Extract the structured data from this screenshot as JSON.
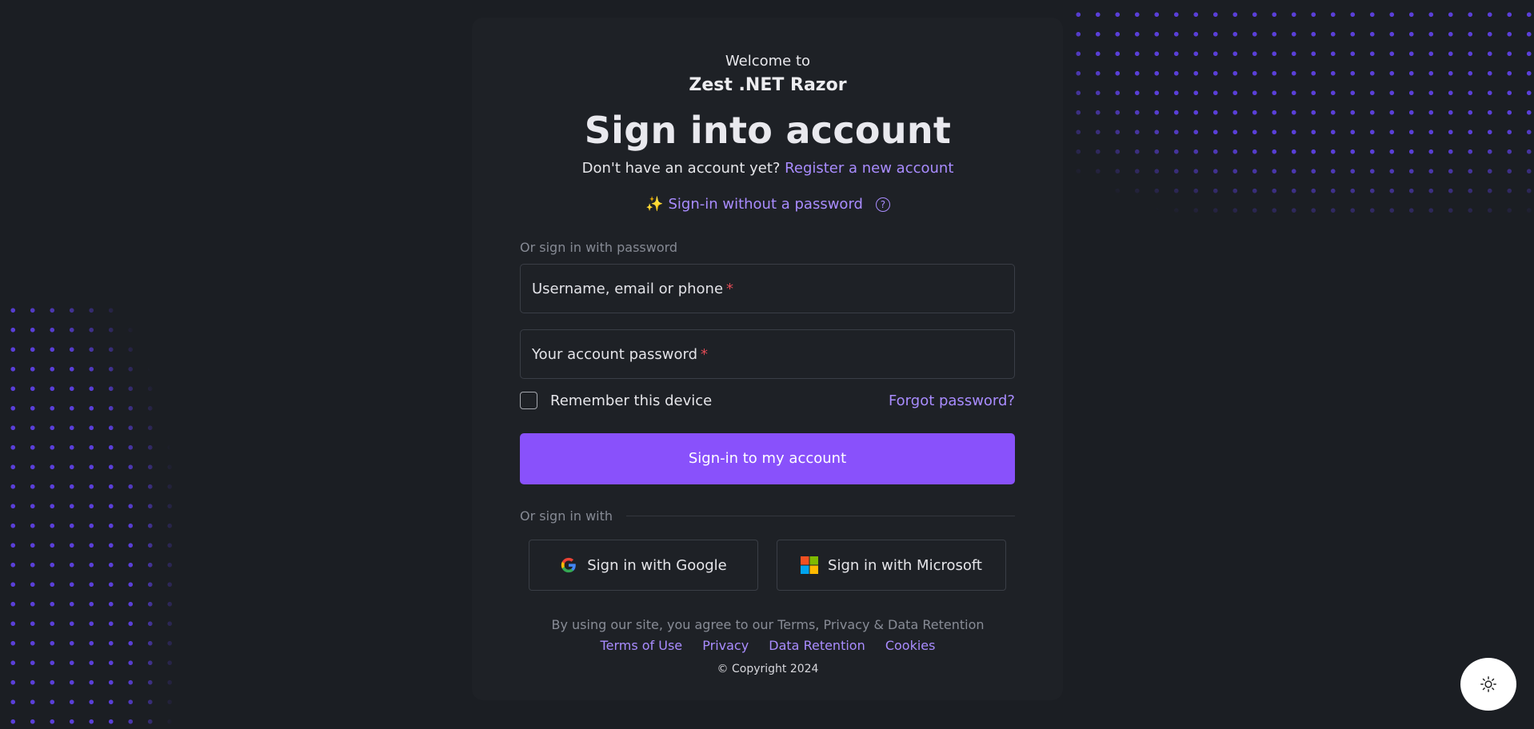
{
  "header": {
    "welcome": "Welcome to",
    "app_name": "Zest .NET Razor",
    "title": "Sign into account"
  },
  "register": {
    "prompt": "Don't have an account yet?",
    "link_label": "Register a new account"
  },
  "passwordless": {
    "emoji": "✨",
    "label": "Sign-in without a password",
    "help_icon": "question-circle-icon"
  },
  "password_section": {
    "label": "Or sign in with password",
    "username_label": "Username, email or phone",
    "password_label": "Your account password",
    "required_marker": "*",
    "remember_label": "Remember this device",
    "remember_checked": false,
    "forgot_label": "Forgot password?",
    "submit_label": "Sign-in to my account"
  },
  "social": {
    "label": "Or sign in with",
    "google_label": "Sign in with Google",
    "microsoft_label": "Sign in with Microsoft"
  },
  "footer": {
    "terms_text": "By using our site, you agree to our Terms, Privacy & Data Retention",
    "links": [
      "Terms of Use",
      "Privacy",
      "Data Retention",
      "Cookies"
    ],
    "copyright": "© Copyright 2024"
  },
  "theme_toggle": {
    "icon": "sun-icon"
  },
  "colors": {
    "background": "#1b1e23",
    "accent": "#8951fb",
    "link": "#a98cff",
    "dots": "#5a3fd9",
    "required": "#e04b55"
  }
}
